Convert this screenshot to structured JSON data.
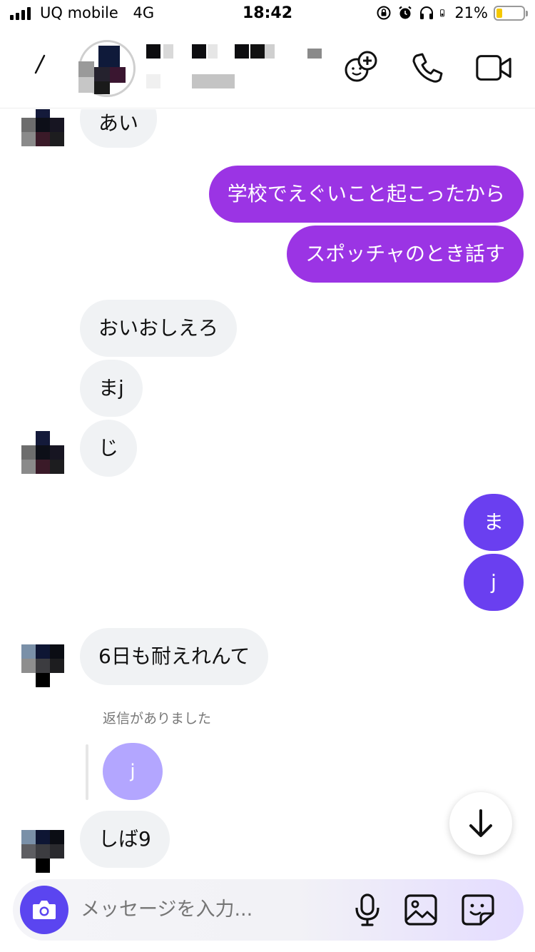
{
  "status_bar": {
    "carrier": "UQ mobile",
    "network": "4G",
    "time": "18:42",
    "battery_text": "21%",
    "battery_level": 0.21
  },
  "header": {
    "back_icon": "back-chevron-icon",
    "actions": [
      "add-friend-icon",
      "phone-icon",
      "video-camera-icon"
    ]
  },
  "messages": [
    {
      "id": "m1",
      "direction": "in",
      "text": "あい"
    },
    {
      "id": "m2",
      "direction": "out",
      "text": "学校でえぐいこと起こったから"
    },
    {
      "id": "m3",
      "direction": "out",
      "text": "スポッチャのとき話す"
    },
    {
      "id": "m4",
      "direction": "in",
      "text": "おいおしえろ"
    },
    {
      "id": "m5",
      "direction": "in",
      "text": "まj"
    },
    {
      "id": "m6",
      "direction": "in",
      "text": "じ"
    },
    {
      "id": "m7",
      "direction": "out",
      "text": "ま"
    },
    {
      "id": "m8",
      "direction": "out",
      "text": "j"
    },
    {
      "id": "m9",
      "direction": "in",
      "text": "6日も耐えれんて"
    },
    {
      "id": "m10",
      "direction": "in",
      "text": "しば9"
    }
  ],
  "reply": {
    "label": "返信がありました",
    "quoted_text": "j"
  },
  "composer": {
    "placeholder": "メッセージを入力..."
  },
  "colors": {
    "outgoing_purple": "#9b34e4",
    "outgoing_violet": "#6a3ff0",
    "incoming_bg": "#f0f2f4",
    "accent": "#5b45f0"
  }
}
